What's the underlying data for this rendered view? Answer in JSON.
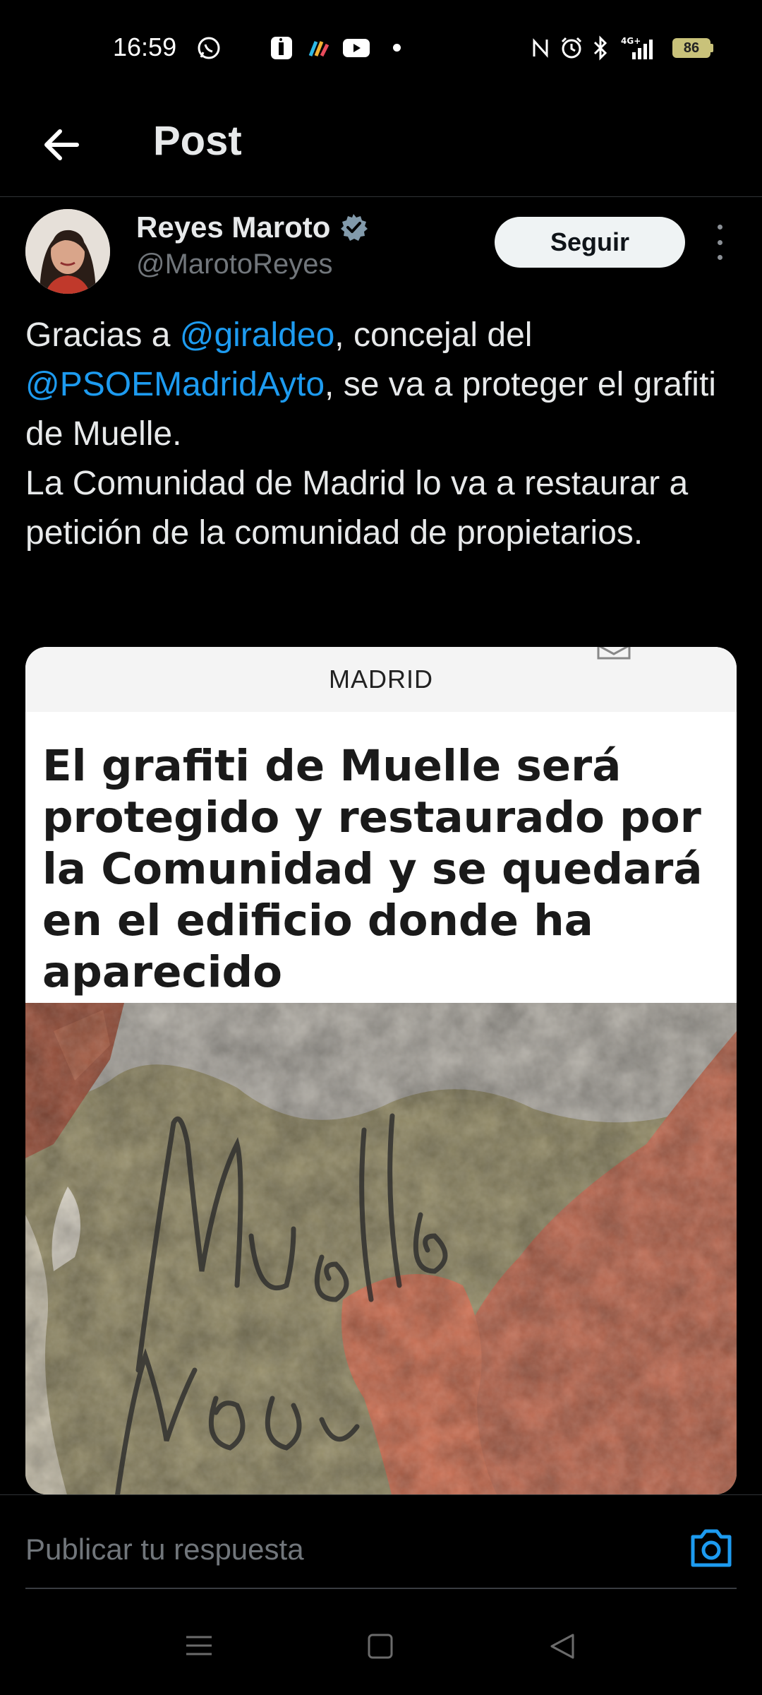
{
  "status_bar": {
    "time": "16:59",
    "battery": "86",
    "icons": [
      "whatsapp-icon",
      "app-icon",
      "color-app-icon",
      "youtube-icon",
      "nfc-icon",
      "alarm-icon",
      "bluetooth-icon",
      "4g-signal-icon",
      "battery-icon"
    ]
  },
  "header": {
    "title": "Post",
    "back_icon": "arrow-left-icon"
  },
  "author": {
    "name": "Reyes Maroto",
    "handle": "@MarotoReyes",
    "verified": true,
    "follow_label": "Seguir"
  },
  "post": {
    "t1": "Gracias a ",
    "m1": "@giraldeo",
    "t2": ", concejal del",
    "m2": "@PSOEMadridAyto",
    "t3": ", se va a proteger el grafiti de Muelle.",
    "t4": "La Comunidad de Madrid lo va a restaurar a petición de la comunidad de propietarios."
  },
  "card": {
    "section": "MADRID",
    "headline": "El grafiti de Muelle será protegido y restaurado por la Comunidad y se quedará en el edificio donde ha aparecido"
  },
  "reply": {
    "placeholder": "Publicar tu respuesta"
  },
  "colors": {
    "accent": "#1d9bf0",
    "background": "#000000",
    "text": "#e7e9ea",
    "muted": "#71767b"
  }
}
